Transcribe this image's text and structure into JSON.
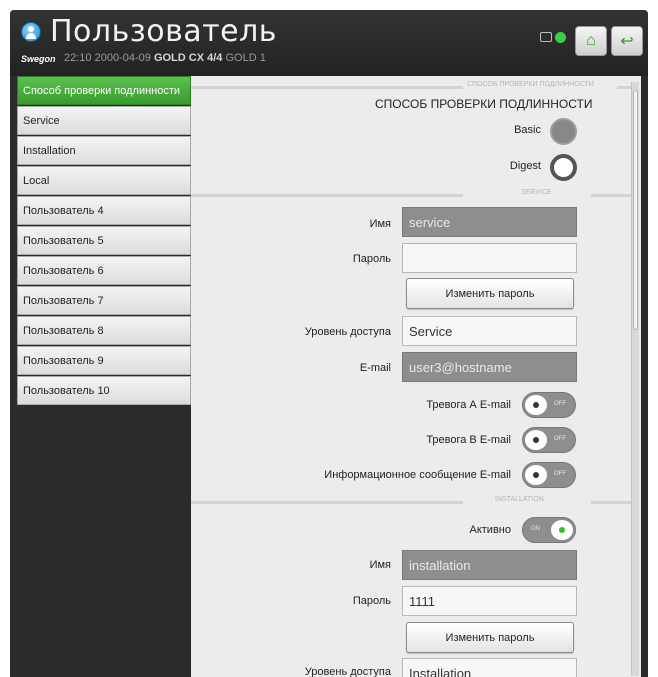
{
  "header": {
    "title": "Пользователь",
    "brand": "Swegon",
    "time": "22:10",
    "date": "2000-04-09",
    "model": "GOLD CX 4/4",
    "unit": "GOLD 1",
    "home_icon": "home-icon",
    "back_icon": "back-arrow-icon"
  },
  "sidebar": {
    "items": [
      {
        "label": "Способ проверки подлинности"
      },
      {
        "label": "Service"
      },
      {
        "label": "Installation"
      },
      {
        "label": "Local"
      },
      {
        "label": "Пользователь 4"
      },
      {
        "label": "Пользователь 5"
      },
      {
        "label": "Пользователь 6"
      },
      {
        "label": "Пользователь 7"
      },
      {
        "label": "Пользователь 8"
      },
      {
        "label": "Пользователь 9"
      },
      {
        "label": "Пользователь 10"
      }
    ]
  },
  "auth": {
    "section": "СПОСОБ ПРОВЕРКИ ПОДЛИННОСТИ",
    "heading": "СПОСОБ ПРОВЕРКИ ПОДЛИННОСТИ",
    "basic_label": "Basic",
    "digest_label": "Digest",
    "selected": "Digest"
  },
  "service": {
    "section": "SERVICE",
    "name_label": "Имя",
    "name_value": "service",
    "password_label": "Пароль",
    "password_value": "",
    "change_password": "Изменить пароль",
    "access_label": "Уровень доступа",
    "access_value": "Service",
    "email_label": "E-mail",
    "email_value": "user3@hostname",
    "alarm_a_label": "Тревога А E-mail",
    "alarm_b_label": "Тревога В E-mail",
    "info_label": "Информационное сообщение E-mail",
    "off_text": "OFF"
  },
  "installation": {
    "section": "INSTALLATION",
    "active_label": "Активно",
    "on_text": "ON",
    "name_label": "Имя",
    "name_value": "installation",
    "password_label": "Пароль",
    "password_value": "1111",
    "change_password": "Изменить пароль",
    "access_label": "Уровень доступа",
    "access_value": "Installation"
  }
}
